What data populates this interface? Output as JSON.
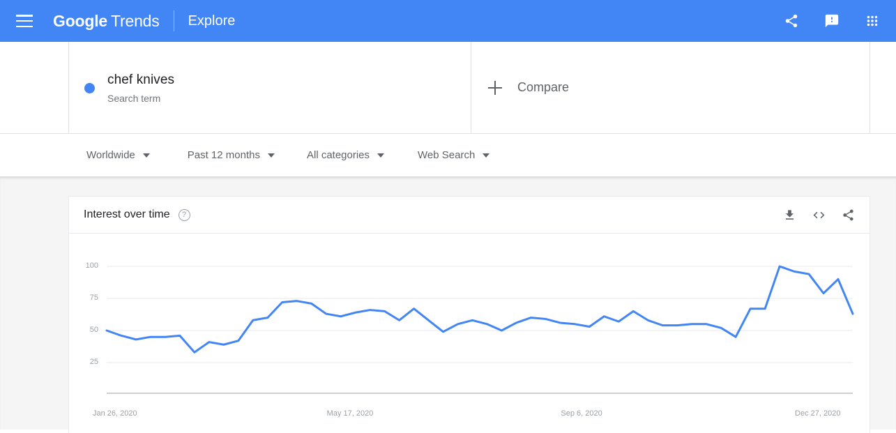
{
  "appbar": {
    "menu_icon": "hamburger-icon",
    "brand_google": "Google",
    "brand_trends": "Trends",
    "explore": "Explore",
    "share_icon": "share-icon",
    "feedback_icon": "feedback-icon",
    "apps_icon": "apps-grid-icon",
    "background_color": "#4285f4"
  },
  "term": {
    "label": "chef knives",
    "type": "Search term",
    "dot_color": "#4285f4"
  },
  "compare": {
    "label": "Compare",
    "plus_icon": "plus-icon"
  },
  "filters": [
    {
      "label": "Worldwide",
      "icon": "chevron-down-icon"
    },
    {
      "label": "Past 12 months",
      "icon": "chevron-down-icon"
    },
    {
      "label": "All categories",
      "icon": "chevron-down-icon"
    },
    {
      "label": "Web Search",
      "icon": "chevron-down-icon"
    }
  ],
  "card": {
    "title": "Interest over time",
    "help_icon": "help-circle-icon",
    "help_glyph": "?",
    "download_icon": "download-icon",
    "embed_icon": "embed-code-icon",
    "share_icon": "share-icon"
  },
  "chart_data": {
    "type": "line",
    "title": "Interest over time",
    "xlabel": "",
    "ylabel": "",
    "ylim": [
      0,
      110
    ],
    "yticks": [
      100,
      75,
      50,
      25
    ],
    "grid": true,
    "legend": false,
    "line_color": "#4285f4",
    "xtick_labels": [
      "Jan 26, 2020",
      "May 17, 2020",
      "Sep 6, 2020",
      "Dec 27, 2020"
    ],
    "xtick_indices": [
      0,
      16,
      32,
      48
    ],
    "x": [
      "Jan 26, 2020",
      "Feb 2, 2020",
      "Feb 9, 2020",
      "Feb 16, 2020",
      "Feb 23, 2020",
      "Mar 1, 2020",
      "Mar 8, 2020",
      "Mar 15, 2020",
      "Mar 22, 2020",
      "Mar 29, 2020",
      "Apr 5, 2020",
      "Apr 12, 2020",
      "Apr 19, 2020",
      "Apr 26, 2020",
      "May 3, 2020",
      "May 10, 2020",
      "May 17, 2020",
      "May 24, 2020",
      "May 31, 2020",
      "Jun 7, 2020",
      "Jun 14, 2020",
      "Jun 21, 2020",
      "Jun 28, 2020",
      "Jul 5, 2020",
      "Jul 12, 2020",
      "Jul 19, 2020",
      "Jul 26, 2020",
      "Aug 2, 2020",
      "Aug 9, 2020",
      "Aug 16, 2020",
      "Aug 23, 2020",
      "Aug 30, 2020",
      "Sep 6, 2020",
      "Sep 13, 2020",
      "Sep 20, 2020",
      "Sep 27, 2020",
      "Oct 4, 2020",
      "Oct 11, 2020",
      "Oct 18, 2020",
      "Oct 25, 2020",
      "Nov 1, 2020",
      "Nov 8, 2020",
      "Nov 15, 2020",
      "Nov 22, 2020",
      "Nov 29, 2020",
      "Dec 6, 2020",
      "Dec 13, 2020",
      "Dec 20, 2020",
      "Dec 27, 2020",
      "Jan 3, 2021",
      "Jan 10, 2021",
      "Jan 17, 2021"
    ],
    "series": [
      {
        "name": "chef knives",
        "color": "#4285f4",
        "values": [
          50,
          46,
          43,
          45,
          45,
          46,
          33,
          41,
          39,
          42,
          58,
          60,
          72,
          73,
          71,
          63,
          61,
          64,
          66,
          65,
          58,
          67,
          58,
          49,
          55,
          58,
          55,
          50,
          56,
          60,
          59,
          56,
          55,
          53,
          61,
          57,
          65,
          58,
          54,
          54,
          55,
          55,
          52,
          45,
          67,
          67,
          100,
          96,
          94,
          79,
          90,
          63
        ]
      }
    ]
  }
}
